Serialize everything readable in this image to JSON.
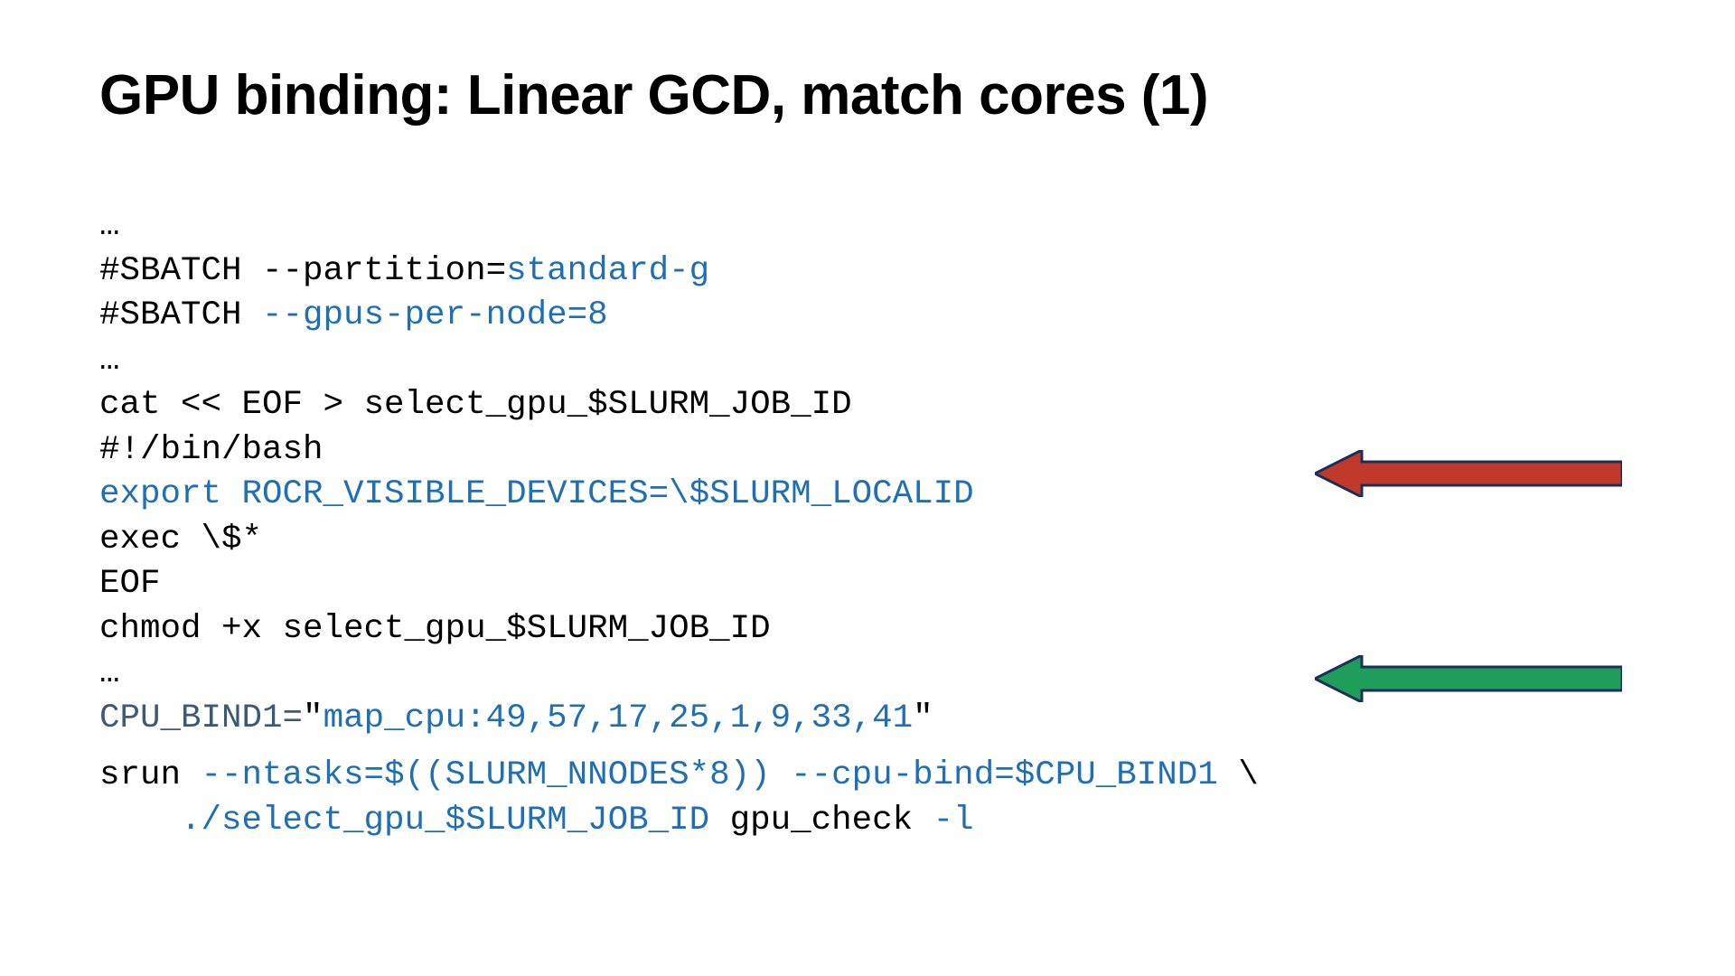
{
  "title": "GPU binding: Linear GCD, match cores (1)",
  "code": {
    "l1": "…",
    "l2a": "#SBATCH --partition=",
    "l2b": "standard-g",
    "l3a": "#SBATCH ",
    "l3b": "--gpus-per-node=8",
    "l4": "…",
    "l5": "cat << EOF > select_gpu_$SLURM_JOB_ID",
    "l6": "#!/bin/bash",
    "l7": "export ROCR_VISIBLE_DEVICES=\\$SLURM_LOCALID",
    "l8": "exec \\$*",
    "l9": "EOF",
    "l10": "chmod +x select_gpu_$SLURM_JOB_ID",
    "l11": "…",
    "l12a": "CPU_BIND1=",
    "l12b": "\"",
    "l12c": "map_cpu:49,57,17,25,1,9,33,41",
    "l12d": "\"",
    "l13a": "srun ",
    "l13b": "--ntasks=$((SLURM_NNODES*8))",
    "l13c": " ",
    "l13d": "--cpu-bind=$CPU_BIND1",
    "l13e": " \\",
    "l14a": "    ",
    "l14b": "./select_gpu_$SLURM_JOB_ID",
    "l14c": " gpu_check ",
    "l14d": "-l"
  },
  "colors": {
    "highlight": "#1f6fb2",
    "arrow_red_fill": "#c0392b",
    "arrow_red_stroke": "#1c2e5b",
    "arrow_green_fill": "#1e9e58",
    "arrow_green_stroke": "#1c2e5b"
  }
}
